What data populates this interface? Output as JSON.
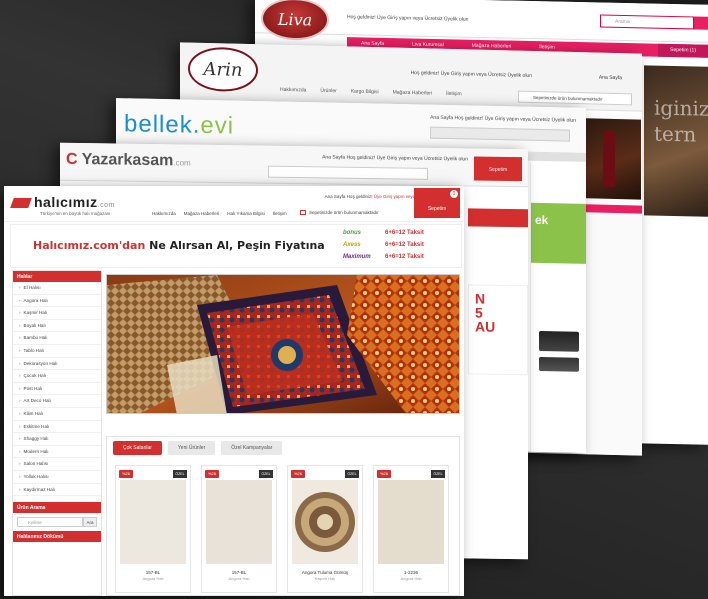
{
  "liva": {
    "logo": "Liva",
    "welcome": "Hoş geldiniz! Üye Giriş yapın veya Ücretsiz Üyelik olun",
    "search_placeholder": "Arama",
    "nav": [
      "Ana Sayfa",
      "Liva Kurumsal",
      "Mağaza Haberleri",
      "İletişim"
    ],
    "cart": "Sepetim (1)",
    "promo_text": [
      "iginizi",
      "tern"
    ]
  },
  "arin": {
    "logo": "Arin",
    "welcome": "Hoş geldiniz! Üye Giriş yapın veya Ücretsiz Üyelik olun",
    "links": "Ana Sayfa",
    "nav": [
      "Hakkımızda",
      "Ürünler",
      "Kargo Bilgisi",
      "Mağaza Haberleri",
      "İletişim"
    ],
    "cart_bar": "Sepetinizde ürün bulunmamaktadır"
  },
  "bellek": {
    "logo_main": "bellek.",
    "logo_accent": "evi",
    "welcome": "Ana Sayfa  Hoş geldiniz! Üye Giriş yapın veya Ücretsiz Üyelik olun",
    "promo": "ek"
  },
  "yazar": {
    "logo_main": "Yazarkasam",
    "logo_accent": ".com",
    "welcome": "Ana Sayfa  Hoş geldiniz! Üye Giriş yapın veya Ücretsiz Üyelik olun",
    "cart": "Sepetim",
    "promo": [
      "N",
      "5",
      "AU"
    ]
  },
  "hali": {
    "logo_main": "halıcımız",
    "logo_accent": ".com",
    "tagline": "Türkiye'nin en büyük halı mağazası",
    "topnav": [
      "Hakkımızda",
      "Mağaza Haberleri",
      "Halı Yıkama Bilgisi",
      "İletişim"
    ],
    "welcome_prefix": "Ana Sayfa  Hoş geldiniz!",
    "welcome_link": "Üye Giriş yapın veya Ücretsiz Üyelik olun",
    "cart_text": "Sepetinizde ürün bulunmamaktadır",
    "cart_label": "Sepetim",
    "cart_count": "0",
    "slogan_brand": "Halıcımız.com'dan",
    "slogan_rest": "Ne Alırsan Al, Peşin Fiyatına",
    "cards": [
      {
        "brand": "bonus",
        "text": "6+6=12 Taksit",
        "color": "#3aa83a"
      },
      {
        "brand": "Axess",
        "text": "6+6=12 Taksit",
        "color": "#c8a000"
      },
      {
        "brand": "Maximum",
        "text": "6+6=12 Taksit",
        "color": "#6d2a8a"
      }
    ],
    "categories_title": "Halılar",
    "categories": [
      "El Halısı",
      "Angora Halı",
      "Kaşmir Halı",
      "Boyalı Halı",
      "Bambu Halı",
      "Tablo Halı",
      "Dekorasyon Halı",
      "Çocuk Halı",
      "Post Halı",
      "Art Deco Halı",
      "Kilim Halı",
      "Eskitme Halı",
      "Shaggy Halı",
      "Modern Halı",
      "Salon Halısı",
      "Yolluk Halısı",
      "Kaydırmaz Halı"
    ],
    "search_title": "Ürün Arama",
    "search_placeholder": "Kelime",
    "search_btn": "Ara",
    "bottom_title": "Halılarımız Dökümü",
    "tabs": [
      "Çok Satanlar",
      "Yeni Ürünler",
      "Özel Kampanyalar"
    ],
    "products": [
      {
        "discount": "%26",
        "tag": "ÖZEL",
        "name": "157-BL",
        "brand": "Angora Halı",
        "color": "#ece8e0"
      },
      {
        "discount": "%26",
        "tag": "ÖZEL",
        "name": "157-BL",
        "brand": "Angora Halı",
        "color": "#e8e2d8"
      },
      {
        "discount": "%26",
        "tag": "ÖZEL",
        "name": "Angora Tuluma Gümüş",
        "brand": "Kaşmir Halı",
        "color": "#d8c8a8"
      },
      {
        "discount": "%26",
        "tag": "ÖZEL",
        "name": "1-2236",
        "brand": "Angora Halı",
        "color": "#e4dccc"
      }
    ]
  }
}
